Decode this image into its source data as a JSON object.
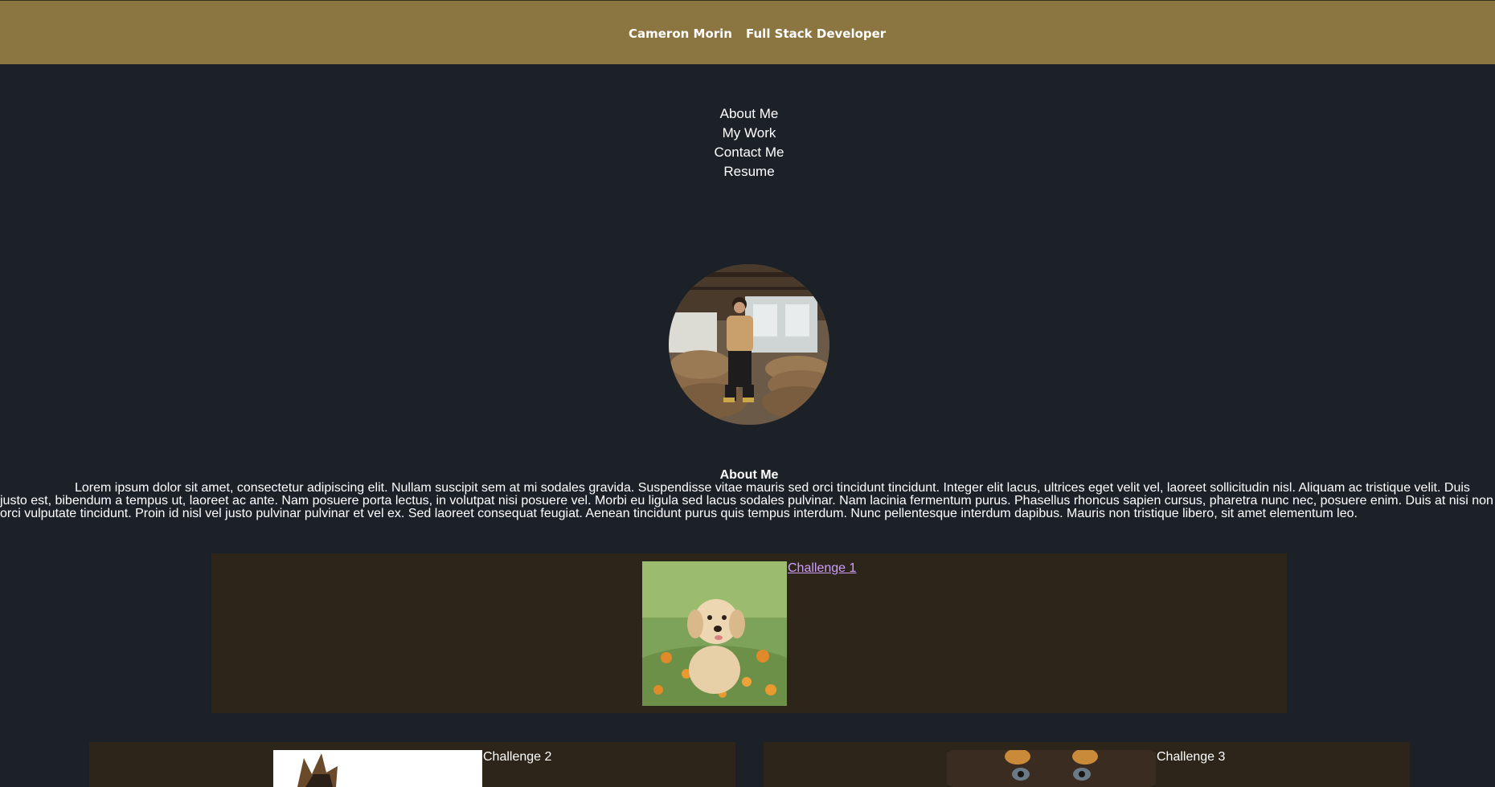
{
  "header": {
    "name": "Cameron Morin",
    "role": "Full Stack Developer"
  },
  "nav": {
    "items": [
      {
        "label": "About Me"
      },
      {
        "label": "My Work"
      },
      {
        "label": "Contact Me"
      },
      {
        "label": "Resume"
      }
    ]
  },
  "about": {
    "heading": "About Me",
    "text": "Lorem ipsum dolor sit amet, consectetur adipiscing elit. Nullam suscipit sem at mi sodales gravida. Suspendisse vitae mauris sed orci tincidunt tincidunt. Integer elit lacus, ultrices eget velit vel, laoreet sollicitudin nisl. Aliquam ac tristique velit. Duis justo est, bibendum a tempus ut, laoreet ac ante. Nam posuere porta lectus, in volutpat nisi posuere vel. Morbi eu ligula sed lacus sodales pulvinar. Nam lacinia fermentum purus. Phasellus rhoncus sapien cursus, pharetra nunc nec, posuere enim. Duis at nisi non orci vulputate tincidunt. Proin id nisl vel justo pulvinar pulvinar et vel ex. Sed laoreet consequat feugiat. Aenean tincidunt purus quis tempus interdum. Nunc pellentesque interdum dapibus. Mauris non tristique libero, sit amet elementum leo."
  },
  "work": {
    "items": [
      {
        "label": "Challenge 1"
      },
      {
        "label": "Challenge 2"
      },
      {
        "label": "Challenge 3"
      }
    ]
  }
}
